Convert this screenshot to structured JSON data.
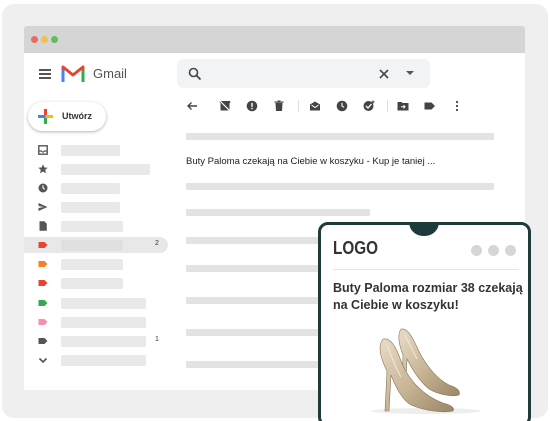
{
  "window": {
    "dots": [
      "#e76c5c",
      "#f0c04a",
      "#5dc15b"
    ]
  },
  "header": {
    "app_name": "Gmail"
  },
  "compose": {
    "label": "Utwórz"
  },
  "sidebar": {
    "items": [
      {
        "icon": "inbox-icon",
        "count": ""
      },
      {
        "icon": "star-icon",
        "count": ""
      },
      {
        "icon": "clock-icon",
        "count": ""
      },
      {
        "icon": "send-icon",
        "count": ""
      },
      {
        "icon": "draft-icon",
        "count": ""
      },
      {
        "icon": "label-icon",
        "color": "#ea4335",
        "count": "2"
      },
      {
        "icon": "label-icon",
        "color": "#f4802a",
        "count": ""
      },
      {
        "icon": "label-icon",
        "color": "#ea4335",
        "count": ""
      },
      {
        "icon": "label-icon",
        "color": "#34a853",
        "count": ""
      },
      {
        "icon": "label-icon",
        "color": "#f48fb1",
        "count": ""
      },
      {
        "icon": "label-icon",
        "color": "#555555",
        "count": "1"
      },
      {
        "icon": "chevron-down-icon",
        "count": ""
      }
    ]
  },
  "email": {
    "subject": "Buty Paloma czekają na Ciebie w koszyku - Kup je taniej ..."
  },
  "phone": {
    "logo": "LOGO",
    "message": "Buty Paloma rozmiar 38 czekają na Ciebie w koszyku!"
  }
}
